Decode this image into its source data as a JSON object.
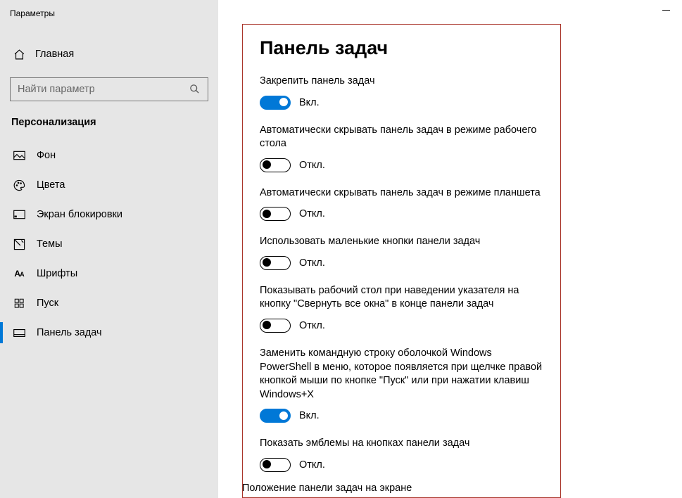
{
  "window": {
    "title": "Параметры"
  },
  "sidebar": {
    "home": "Главная",
    "search_placeholder": "Найти параметр",
    "section": "Персонализация",
    "items": [
      {
        "label": "Фон"
      },
      {
        "label": "Цвета"
      },
      {
        "label": "Экран блокировки"
      },
      {
        "label": "Темы"
      },
      {
        "label": "Шрифты"
      },
      {
        "label": "Пуск"
      },
      {
        "label": "Панель задач"
      }
    ]
  },
  "page": {
    "title": "Панель задач",
    "on_label": "Вкл.",
    "off_label": "Откл.",
    "settings": [
      {
        "label": "Закрепить панель задач",
        "on": true
      },
      {
        "label": "Автоматически скрывать панель задач в режиме рабочего стола",
        "on": false
      },
      {
        "label": "Автоматически скрывать панель задач в режиме планшета",
        "on": false
      },
      {
        "label": "Использовать маленькие кнопки панели задач",
        "on": false
      },
      {
        "label": "Показывать рабочий стол при наведении указателя на кнопку \"Свернуть все окна\" в конце панели задач",
        "on": false
      },
      {
        "label": "Заменить командную строку оболочкой Windows PowerShell в меню, которое появляется при щелчке правой кнопкой мыши по кнопке \"Пуск\" или при нажатии клавиш Windows+X",
        "on": true
      },
      {
        "label": "Показать эмблемы на кнопках панели задач",
        "on": false
      }
    ],
    "footer": "Положение панели задач на экране"
  }
}
